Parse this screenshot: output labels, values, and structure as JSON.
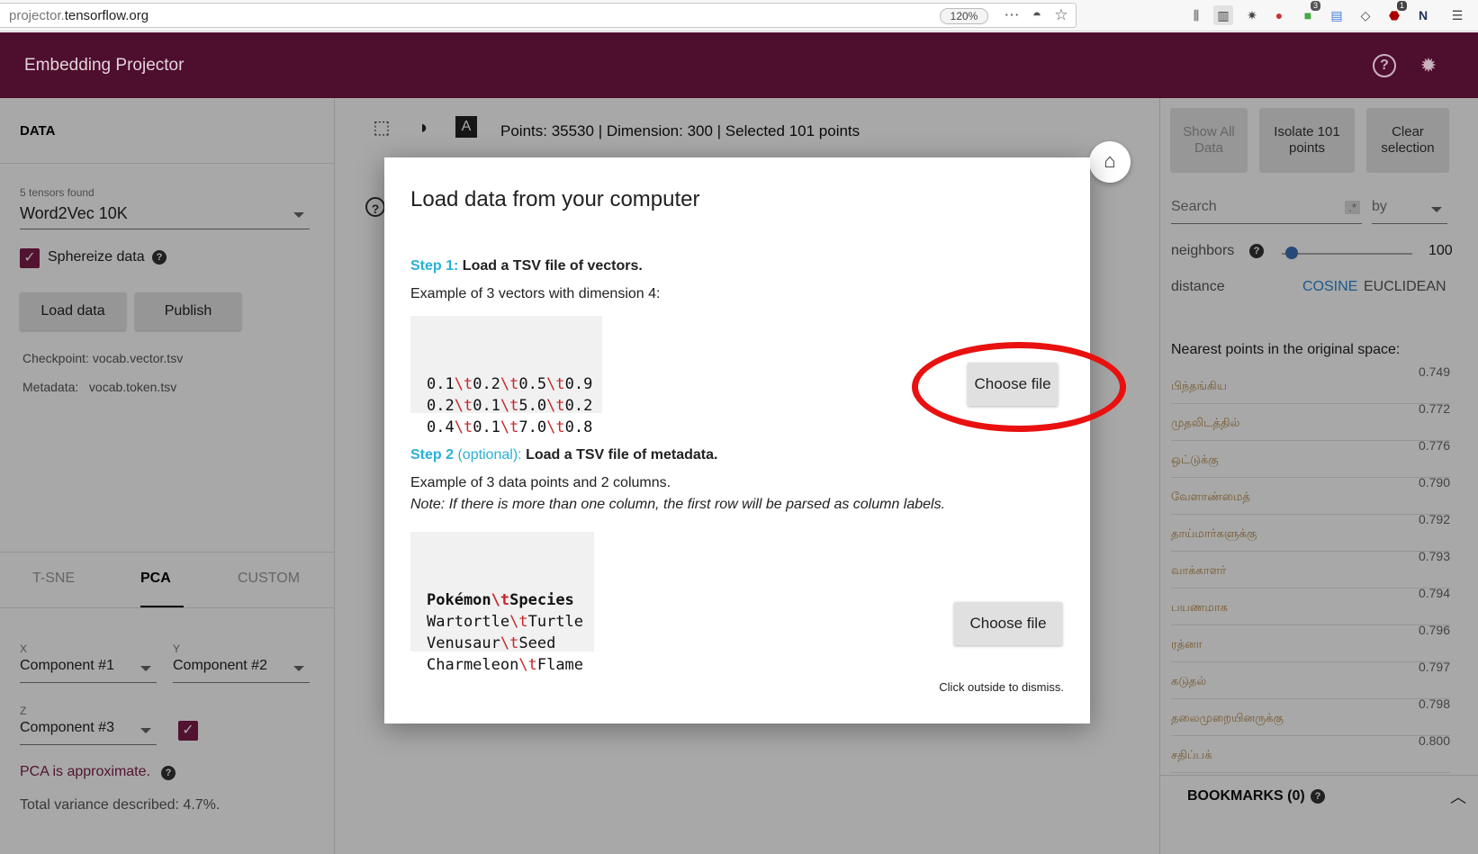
{
  "browser": {
    "url_host": "projector.",
    "url_domain": "tensorflow.org",
    "zoom": "120%",
    "badge_a": "3",
    "badge_b": "1"
  },
  "header": {
    "title": "Embedding Projector"
  },
  "left_panel": {
    "section_title": "DATA",
    "tensors_found": "5 tensors found",
    "tensor_selected": "Word2Vec 10K",
    "spherize_label": "Sphereize data",
    "load_button": "Load data",
    "publish_button": "Publish",
    "checkpoint": "Checkpoint: vocab.vector.tsv",
    "metadata": "Metadata:   vocab.token.tsv",
    "tabs": [
      "T-SNE",
      "PCA",
      "CUSTOM"
    ],
    "x_label": "X",
    "y_label": "Y",
    "z_label": "Z",
    "x_value": "Component #1",
    "y_value": "Component #2",
    "z_value": "Component #3",
    "pca_approx": "PCA is approximate.",
    "variance": "Total variance described: 4.7%."
  },
  "toolbar": {
    "points_info": "Points: 35530 | Dimension: 300 | Selected 101 points"
  },
  "right_panel": {
    "show_all": "Show All Data",
    "isolate": "Isolate 101 points",
    "clear": "Clear selection",
    "search_placeholder": "Search",
    "regex_label": ".*",
    "by_label": "by",
    "neighbors_label": "neighbors",
    "neighbors_value": "100",
    "distance_label": "distance",
    "cosine": "COSINE",
    "euclidean": "EUCLIDEAN",
    "nearest_title": "Nearest points in the original space:",
    "nearest": [
      {
        "word": "பிந்தங்கிய",
        "value": "0.749"
      },
      {
        "word": "முதலிடத்தில்",
        "value": "0.772"
      },
      {
        "word": "ஒட்டுக்கு",
        "value": "0.776"
      },
      {
        "word": "வேளாண்மைத்",
        "value": "0.790"
      },
      {
        "word": "தாய்மார்களுக்கு",
        "value": "0.792"
      },
      {
        "word": "வாக்காளர்",
        "value": "0.793"
      },
      {
        "word": "பயணமாக",
        "value": "0.794"
      },
      {
        "word": "ரத்னா",
        "value": "0.796"
      },
      {
        "word": "கடுதல்",
        "value": "0.797"
      },
      {
        "word": "தலைமுறையினருக்கு",
        "value": "0.798"
      },
      {
        "word": "சதிப்பக்",
        "value": "0.800"
      }
    ],
    "bookmarks": "BOOKMARKS (0)"
  },
  "modal": {
    "title": "Load data from your computer",
    "step1_num": "Step 1:",
    "step1_text": "Load a TSV file of vectors.",
    "step1_example": "Example of 3 vectors with dimension 4:",
    "step1_rows": [
      [
        "0.1",
        "0.2",
        "0.5",
        "0.9"
      ],
      [
        "0.2",
        "0.1",
        "5.0",
        "0.2"
      ],
      [
        "0.4",
        "0.1",
        "7.0",
        "0.8"
      ]
    ],
    "step2_num": "Step 2",
    "step2_opt": "(optional):",
    "step2_text": "Load a TSV file of metadata.",
    "step2_example": "Example of 3 data points and 2 columns.",
    "step2_note": "Note: If there is more than one column, the first row will be parsed as column labels.",
    "step2_header": [
      "Pokémon",
      "Species"
    ],
    "step2_rows": [
      [
        "Wartortle",
        "Turtle"
      ],
      [
        "Venusaur",
        "Seed"
      ],
      [
        "Charmeleon",
        "Flame"
      ]
    ],
    "tab_sep": "\\t",
    "choose_file_1": "Choose file",
    "choose_file_2": "Choose file",
    "dismiss": "Click outside to dismiss."
  },
  "colors": {
    "header_bg": "#4e0e2d",
    "accent": "#7b1e4a",
    "step_blue": "#2ab0d7",
    "annotation_red": "#e8110f"
  }
}
